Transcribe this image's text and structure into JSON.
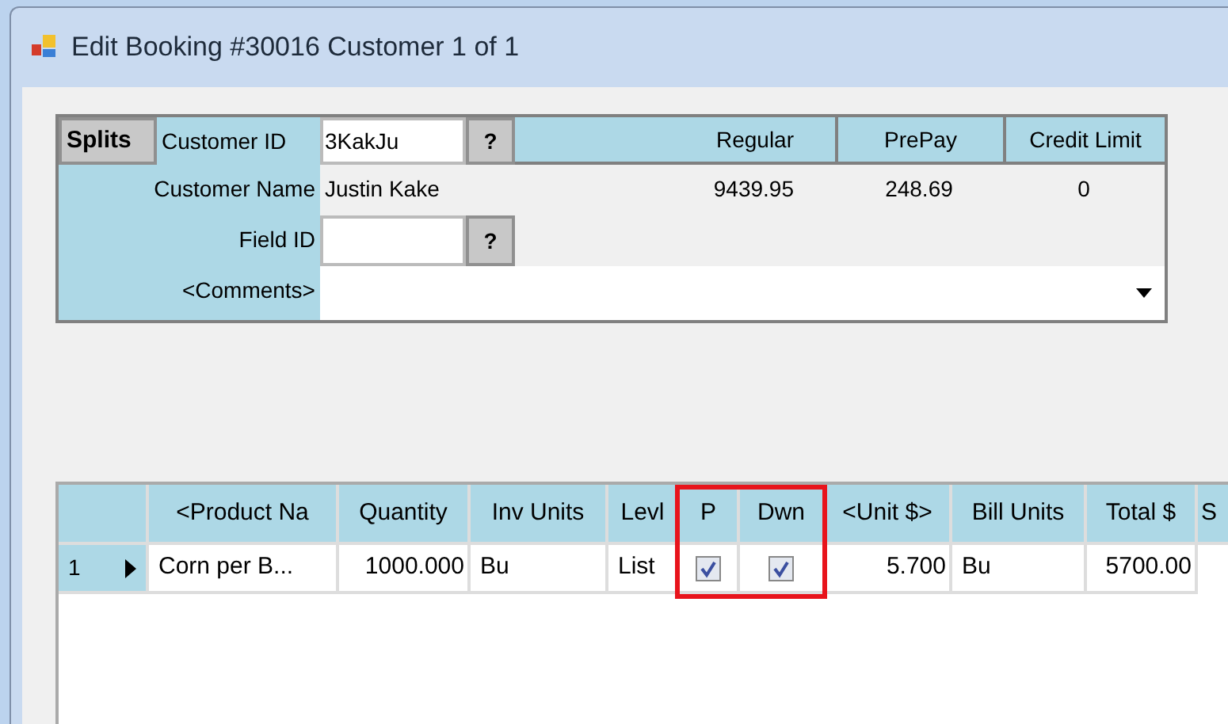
{
  "window": {
    "title": "Edit Booking #30016 Customer 1 of 1"
  },
  "customer": {
    "splits_button": "Splits",
    "customer_id_label": "Customer ID",
    "customer_id": "3KakJu",
    "lookup_button": "?",
    "customer_name_label": "Customer Name",
    "customer_name": "Justin Kake",
    "field_id_label": "Field ID",
    "field_lookup_button": "?",
    "comments_label": "<Comments>",
    "balances": [
      {
        "label": "Regular",
        "value": "9439.95"
      },
      {
        "label": "PrePay",
        "value": "248.69"
      },
      {
        "label": "Credit Limit",
        "value": "0"
      }
    ]
  },
  "grid": {
    "columns": [
      {
        "label": "<Product Na",
        "highlighted": false
      },
      {
        "label": "Quantity",
        "highlighted": false
      },
      {
        "label": "Inv Units",
        "highlighted": false
      },
      {
        "label": "Levl",
        "highlighted": false
      },
      {
        "label": "P",
        "highlighted": true
      },
      {
        "label": "Dwn",
        "highlighted": true
      },
      {
        "label": "<Unit $>",
        "highlighted": false
      },
      {
        "label": "Bill Units",
        "highlighted": false
      },
      {
        "label": "Total $",
        "highlighted": false
      },
      {
        "label": "S",
        "highlighted": false
      }
    ],
    "rows": [
      {
        "number": "1",
        "current": true,
        "cells": [
          {
            "kind": "text",
            "text": "Corn per B..."
          },
          {
            "kind": "number",
            "text": "1000.000"
          },
          {
            "kind": "text",
            "text": "Bu"
          },
          {
            "kind": "text",
            "text": "List"
          },
          {
            "kind": "check",
            "checked": true
          },
          {
            "kind": "check",
            "checked": true
          },
          {
            "kind": "number",
            "text": "5.700"
          },
          {
            "kind": "text",
            "text": "Bu"
          },
          {
            "kind": "number",
            "text": "5700.00"
          }
        ]
      }
    ]
  }
}
